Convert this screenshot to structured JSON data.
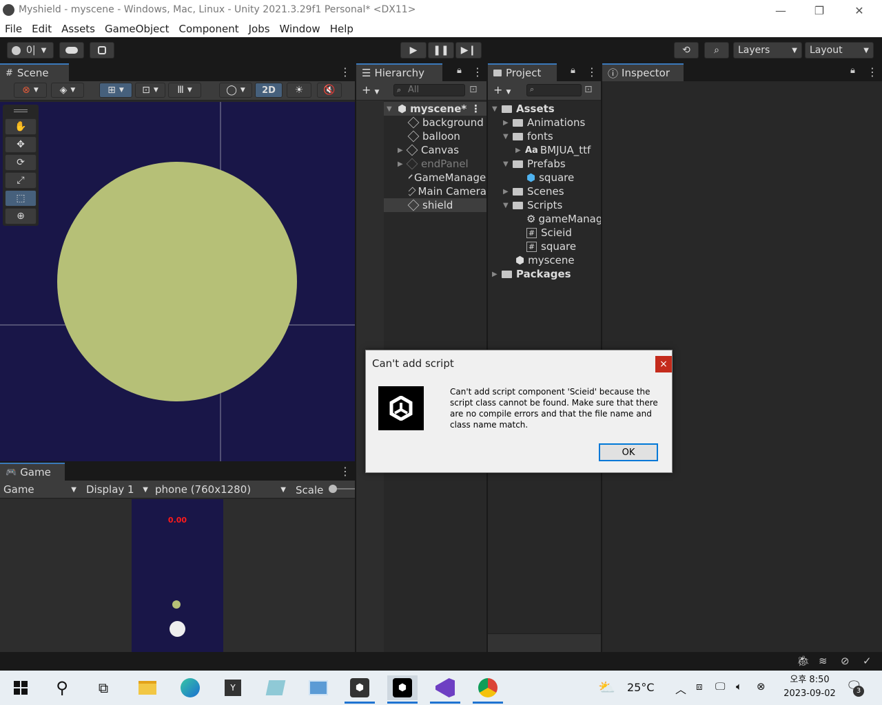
{
  "window": {
    "title": "Myshield - myscene - Windows, Mac, Linux - Unity 2021.3.29f1 Personal* <DX11>",
    "minimize": "—",
    "maximize": "❐",
    "close": "✕"
  },
  "menu": [
    "File",
    "Edit",
    "Assets",
    "GameObject",
    "Component",
    "Jobs",
    "Window",
    "Help"
  ],
  "toolbar": {
    "account_count": "0|",
    "layers_label": "Layers",
    "layout_label": "Layout"
  },
  "scene": {
    "tab_label": "Scene",
    "mode_2d": "2D",
    "background_color": "#191648",
    "circle_color": "#b6c077"
  },
  "game": {
    "tab_label": "Game",
    "view_select": "Game",
    "display_select": "Display 1",
    "resolution_select": "phone (760x1280)",
    "scale_label": "Scale",
    "score_text": "0.00"
  },
  "hierarchy": {
    "tab_label": "Hierarchy",
    "search_placeholder": "All",
    "root": "myscene*",
    "items": [
      {
        "label": "background",
        "expandable": false,
        "dim": false
      },
      {
        "label": "balloon",
        "expandable": false,
        "dim": false
      },
      {
        "label": "Canvas",
        "expandable": true,
        "dim": false
      },
      {
        "label": "endPanel",
        "expandable": true,
        "dim": true
      },
      {
        "label": "GameManager",
        "expandable": false,
        "dim": false
      },
      {
        "label": "Main Camera",
        "expandable": false,
        "dim": false
      },
      {
        "label": "shield",
        "expandable": false,
        "dim": false
      }
    ]
  },
  "project": {
    "tab_label": "Project",
    "tree": {
      "assets": "Assets",
      "animations": "Animations",
      "fonts": "fonts",
      "font_file": "BMJUA_ttf",
      "font_prefix": "Aa",
      "prefabs": "Prefabs",
      "prefab_square": "square",
      "scenes": "Scenes",
      "scripts": "Scripts",
      "script_gamemanager": "gameManager",
      "script_scieid": "Scieid",
      "script_square": "square",
      "scene_myscene": "myscene",
      "packages": "Packages"
    }
  },
  "inspector": {
    "tab_label": "Inspector"
  },
  "dialog": {
    "title": "Can't add script",
    "close": "×",
    "message": "Can't add script component 'Scieid' because the script class cannot be found. Make sure that there are no compile errors and that the file name and class name match.",
    "ok_label": "OK"
  },
  "taskbar": {
    "weather_temp": "25°C",
    "clock_time": "오후 8:50",
    "clock_date": "2023-09-02",
    "notification_count": "3",
    "y_app_label": "Y"
  }
}
